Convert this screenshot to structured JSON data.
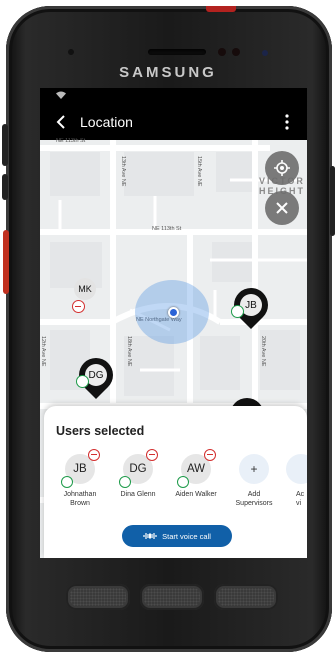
{
  "device": {
    "brand": "SAMSUNG"
  },
  "appbar": {
    "title": "Location"
  },
  "map": {
    "district": "VICTOR\nHEIGHT",
    "streets": {
      "ne113th_top": "NE 113th St",
      "ne113th_mid": "NE 113th St",
      "northgate": "NE Northgate Way",
      "ave13th": "13th Ave NE",
      "ave15th": "15th Ave NE",
      "ave12th": "12th Ave NE",
      "ave18th": "18th Ave NE",
      "ave20th": "20th Ave NE",
      "nd_right": "2nd"
    },
    "pins": {
      "mk": "MK",
      "jb": "JB",
      "dg": "DG"
    }
  },
  "sheet": {
    "heading": "Users selected",
    "users": [
      {
        "initials": "JB",
        "name": "Johnathan\nBrown"
      },
      {
        "initials": "DG",
        "name": "Dina Glenn"
      },
      {
        "initials": "AW",
        "name": "Aiden Walker"
      }
    ],
    "add": {
      "symbol": "+",
      "label": "Add\nSupervisors"
    },
    "partial": {
      "label": "Ac\nvi"
    },
    "voice_button": "Start voice call"
  },
  "colors": {
    "primary": "#1160a8",
    "online": "#1e9b4a",
    "remove": "#d32f2f",
    "location": "#2b63d6"
  }
}
